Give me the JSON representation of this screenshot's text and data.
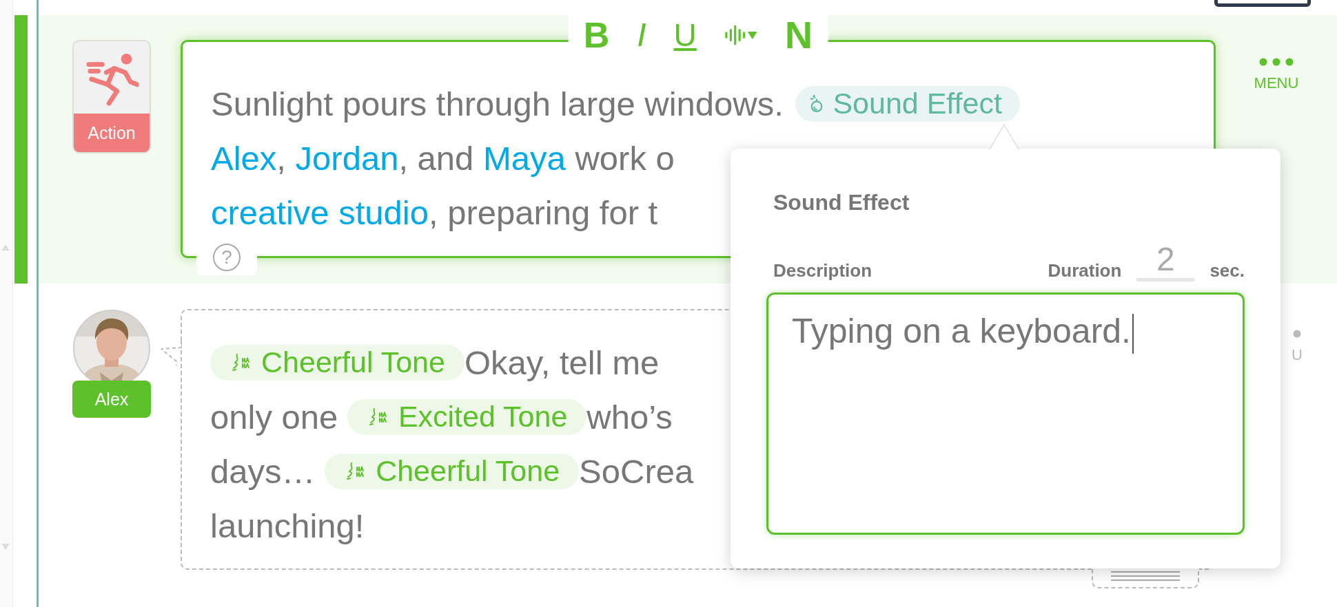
{
  "action_row": {
    "selected": true,
    "badge": "Action",
    "menu": "MENU",
    "help": "?",
    "toolbar": [
      {
        "kind": "bold",
        "label": "B"
      },
      {
        "kind": "italic",
        "label": "I"
      },
      {
        "kind": "underline",
        "label": "U"
      },
      {
        "kind": "voice"
      },
      {
        "kind": "plain",
        "label": "N"
      }
    ],
    "lines": [
      [
        {
          "kind": "text",
          "text": "Sunlight pours through large windows. "
        },
        {
          "kind": "sound",
          "text": "Sound Effect"
        }
      ],
      [
        {
          "kind": "character",
          "text": "Alex"
        },
        {
          "kind": "text",
          "text": ", "
        },
        {
          "kind": "character",
          "text": "Jordan"
        },
        {
          "kind": "text",
          "text": ", and "
        },
        {
          "kind": "character",
          "text": "Maya"
        },
        {
          "kind": "text",
          "text": " work o"
        }
      ],
      [
        {
          "kind": "character",
          "text": "creative studio"
        },
        {
          "kind": "text",
          "text": ", preparing for t"
        }
      ]
    ]
  },
  "dialogue_row": {
    "selected": false,
    "character": "Alex",
    "menu": "U",
    "lines": [
      [
        {
          "kind": "tone",
          "text": "Cheerful Tone"
        },
        {
          "kind": "text",
          "text": "Okay, tell me"
        }
      ],
      [
        {
          "kind": "text",
          "text": "only one "
        },
        {
          "kind": "tone",
          "text": "Excited Tone"
        },
        {
          "kind": "text",
          "text": "who’s"
        }
      ],
      [
        {
          "kind": "text",
          "text": "days… "
        },
        {
          "kind": "tone",
          "text": "Cheerful Tone"
        },
        {
          "kind": "text",
          "text": "SoCrea"
        }
      ],
      [
        {
          "kind": "text",
          "text": "launching!"
        }
      ]
    ]
  },
  "popup": {
    "title": "Sound Effect",
    "description_label": "Description",
    "duration_label": "Duration",
    "duration": "2",
    "unit": "sec.",
    "description": "Typing on a keyboard."
  }
}
